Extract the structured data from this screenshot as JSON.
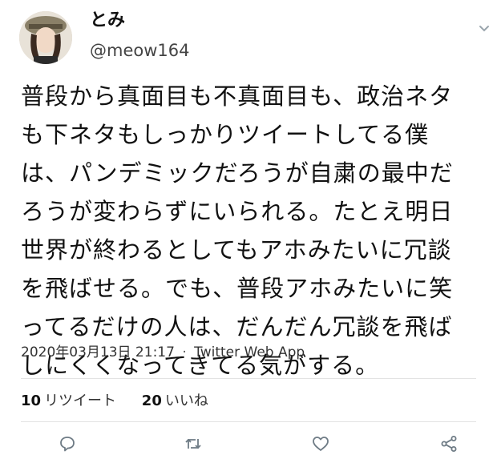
{
  "user": {
    "display_name": "とみ",
    "handle": "@meow164"
  },
  "tweet": {
    "text": "普段から真面目も不真面目も、政治ネタ\nも下ネタもしっかりツイートしてる僕\nは、パンデミックだろうが自粛の最中だ\nろうが変わらずにいられる。たとえ明日\n世界が終わるとしてもアホみたいに冗談\nを飛ばせる。でも、普段アホみたいに笑\nってるだけの人は、だんだん冗談を飛ば\nしにくくなってきてる気がする。",
    "timestamp": "2020年03月13日 21:17",
    "separator": "·",
    "source": "Twitter Web App"
  },
  "stats": {
    "retweets_count": "10",
    "retweets_label": "リツイート",
    "likes_count": "20",
    "likes_label": "いいね"
  },
  "icons": {
    "menu": "chevron-down-icon",
    "reply": "reply-icon",
    "retweet": "retweet-icon",
    "like": "heart-icon",
    "share": "share-icon"
  },
  "colors": {
    "icon_gray": "#6e7b85",
    "divider": "#e3e3e3",
    "text": "#111111"
  }
}
